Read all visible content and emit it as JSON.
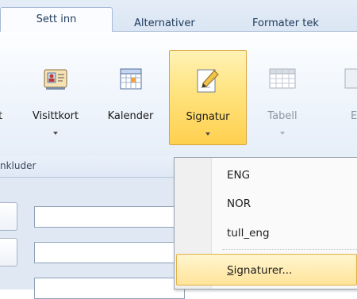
{
  "tabs": [
    {
      "label": "Sett inn",
      "active": true
    },
    {
      "label": "Alternativer",
      "active": false
    },
    {
      "label": "Formater tek",
      "active": false
    }
  ],
  "ribbon": {
    "buttons": [
      {
        "label": "t",
        "icon": "generic-icon",
        "disabled": false
      },
      {
        "label": "Visittkort",
        "icon": "business-card-icon",
        "disabled": false
      },
      {
        "label": "Kalender",
        "icon": "calendar-icon",
        "disabled": false
      },
      {
        "label": "Signatur",
        "icon": "signature-icon",
        "disabled": false,
        "selected": true
      },
      {
        "label": "Tabell",
        "icon": "table-icon",
        "disabled": true
      },
      {
        "label": "E",
        "icon": "picture-icon",
        "disabled": true
      }
    ],
    "group_label": "nkluder"
  },
  "menu": {
    "items": [
      {
        "label": "ENG"
      },
      {
        "label": "NOR"
      },
      {
        "label": "tull_eng"
      }
    ],
    "signatures_item": {
      "underlined": "S",
      "rest": "ignaturer..."
    }
  },
  "colors": {
    "accent_selected": "#ffd04f",
    "ribbon_text": "#1e395b"
  }
}
